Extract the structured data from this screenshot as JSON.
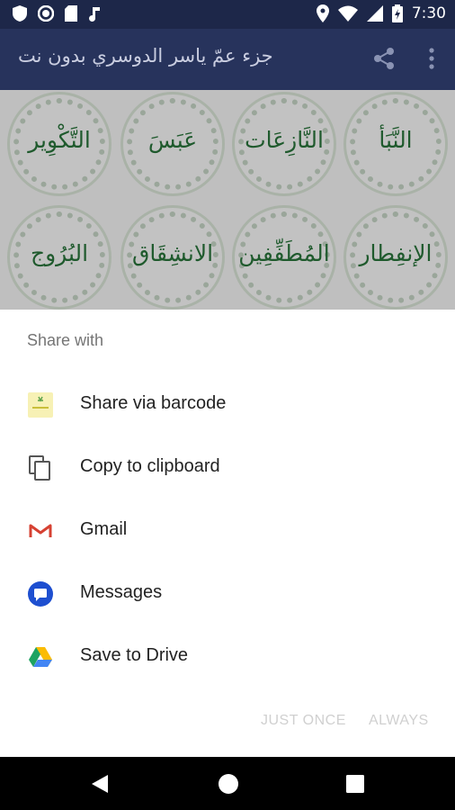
{
  "status_bar": {
    "time": "7:30",
    "icons": [
      "shield-icon",
      "circle-dot-icon",
      "sd-card-icon",
      "music-note-icon",
      "location-icon",
      "wifi-icon",
      "signal-icon",
      "battery-icon"
    ]
  },
  "app_bar": {
    "title": "جزء عمّ ياسر الدوسري بدون نت",
    "share_icon": "share-icon",
    "more_icon": "more-vert-icon"
  },
  "surah_grid": {
    "row1": [
      "النَّبَأ",
      "النَّازِعَات",
      "عَبَسَ",
      "التَّكْوِير"
    ],
    "row2": [
      "الإنفِطار",
      "المُطَفِّفِين",
      "الانشِقَاق",
      "البُرُوج"
    ]
  },
  "share_sheet": {
    "header": "Share with",
    "items": [
      {
        "label": "Share via barcode",
        "icon": "barcode-icon"
      },
      {
        "label": "Copy to clipboard",
        "icon": "clipboard-icon"
      },
      {
        "label": "Gmail",
        "icon": "gmail-icon"
      },
      {
        "label": "Messages",
        "icon": "messages-icon"
      },
      {
        "label": "Save to Drive",
        "icon": "drive-icon"
      }
    ],
    "just_once": "JUST ONCE",
    "always": "ALWAYS"
  },
  "nav_bar": {
    "icons": [
      "back-icon",
      "home-icon",
      "recents-icon"
    ]
  },
  "colors": {
    "status_bar": "#1d2749",
    "app_bar": "#27335c",
    "surah_text": "#1f5a2d",
    "disabled_action": "#d0d0d0"
  }
}
